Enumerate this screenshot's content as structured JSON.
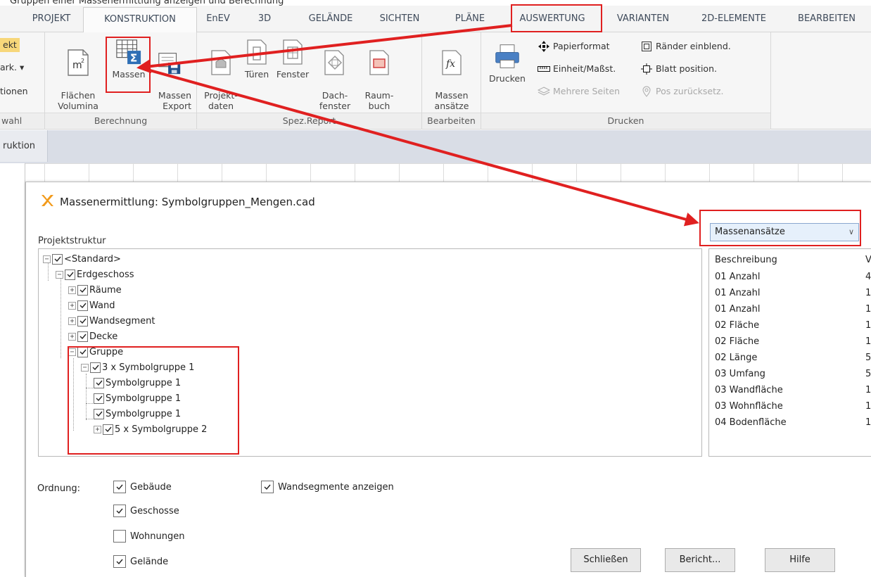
{
  "caption": "Gruppen einer Massenermittlung anzeigen und Berechnung",
  "menu": {
    "tabs": [
      {
        "label": "PROJEKT"
      },
      {
        "label": "KONSTRUKTION"
      },
      {
        "label": "EnEV"
      },
      {
        "label": "3D"
      },
      {
        "label": "GELÄNDE"
      },
      {
        "label": "SICHTEN"
      },
      {
        "label": "PLÄNE"
      },
      {
        "label": "AUSWERTUNG"
      },
      {
        "label": "VARIANTEN"
      },
      {
        "label": "2D-ELEMENTE"
      },
      {
        "label": "BEARBEITEN"
      }
    ]
  },
  "ribbon": {
    "partial": {
      "line1": "ekt",
      "line2": "ark. ▾",
      "line3": "tionen",
      "group": "wahl"
    },
    "berechnung": {
      "label": "Berechnung",
      "flaechen": "Flächen\nVolumina",
      "massen": "Massen",
      "massen_export": "Massen\nExport"
    },
    "spez": {
      "label": "Spez.Report",
      "projekt": "Projekt-\ndaten",
      "tueren": "Türen",
      "fenster": "Fenster",
      "dach": "Dach-\nfenster",
      "raum": "Raum-\nbuch"
    },
    "bearbeiten": {
      "label": "Bearbeiten",
      "massen_ansaetze": "Massen\nansätze"
    },
    "drucken": {
      "label": "Drucken",
      "drucken": "Drucken",
      "papierformat": "Papierformat",
      "einheit": "Einheit/Maßst.",
      "mehrere": "Mehrere Seiten",
      "raender": "Ränder einblend.",
      "blatt": "Blatt position.",
      "pos": "Pos zurücksetz."
    }
  },
  "strip": {
    "label": "ruktion"
  },
  "dialog": {
    "title": "Massenermittlung: Symbolgruppen_Mengen.cad",
    "projektstruktur": "Projektstruktur",
    "tree": [
      {
        "label": "<Standard>"
      },
      {
        "label": "Erdgeschoss"
      },
      {
        "label": "Räume"
      },
      {
        "label": "Wand"
      },
      {
        "label": "Wandsegment"
      },
      {
        "label": "Decke"
      },
      {
        "label": "Gruppe"
      },
      {
        "label": "3 x Symbolgruppe 1"
      },
      {
        "label": "Symbolgruppe 1"
      },
      {
        "label": "Symbolgruppe 1"
      },
      {
        "label": "Symbolgruppe 1"
      },
      {
        "label": "5 x Symbolgruppe 2"
      }
    ],
    "combo": "Massenansätze",
    "right_panel": {
      "col1": "Beschreibung",
      "col2": "V",
      "rows": [
        {
          "desc": "01 Anzahl",
          "val": "4"
        },
        {
          "desc": "01 Anzahl",
          "val": "1"
        },
        {
          "desc": "01 Anzahl",
          "val": "1"
        },
        {
          "desc": "02 Fläche",
          "val": "1"
        },
        {
          "desc": "02 Fläche",
          "val": "1"
        },
        {
          "desc": "02 Länge",
          "val": "5"
        },
        {
          "desc": "03 Umfang",
          "val": "5"
        },
        {
          "desc": "03 Wandfläche",
          "val": "1"
        },
        {
          "desc": "03 Wohnfläche",
          "val": "1"
        },
        {
          "desc": "04 Bodenfläche",
          "val": "1"
        }
      ]
    },
    "ordnung": "Ordnung:",
    "options": {
      "gebaeude": {
        "label": "Gebäude",
        "checked": true
      },
      "geschosse": {
        "label": "Geschosse",
        "checked": true
      },
      "wohnungen": {
        "label": "Wohnungen",
        "checked": false
      },
      "gelaende": {
        "label": "Gelände",
        "checked": true
      },
      "wandsegmente": {
        "label": "Wandsegmente anzeigen",
        "checked": true
      }
    },
    "buttons": {
      "schliessen": "Schließen",
      "bericht": "Bericht...",
      "hilfe": "Hilfe"
    }
  },
  "colors": {
    "annotation": "#e02020",
    "accent": "#2f6fb5"
  }
}
